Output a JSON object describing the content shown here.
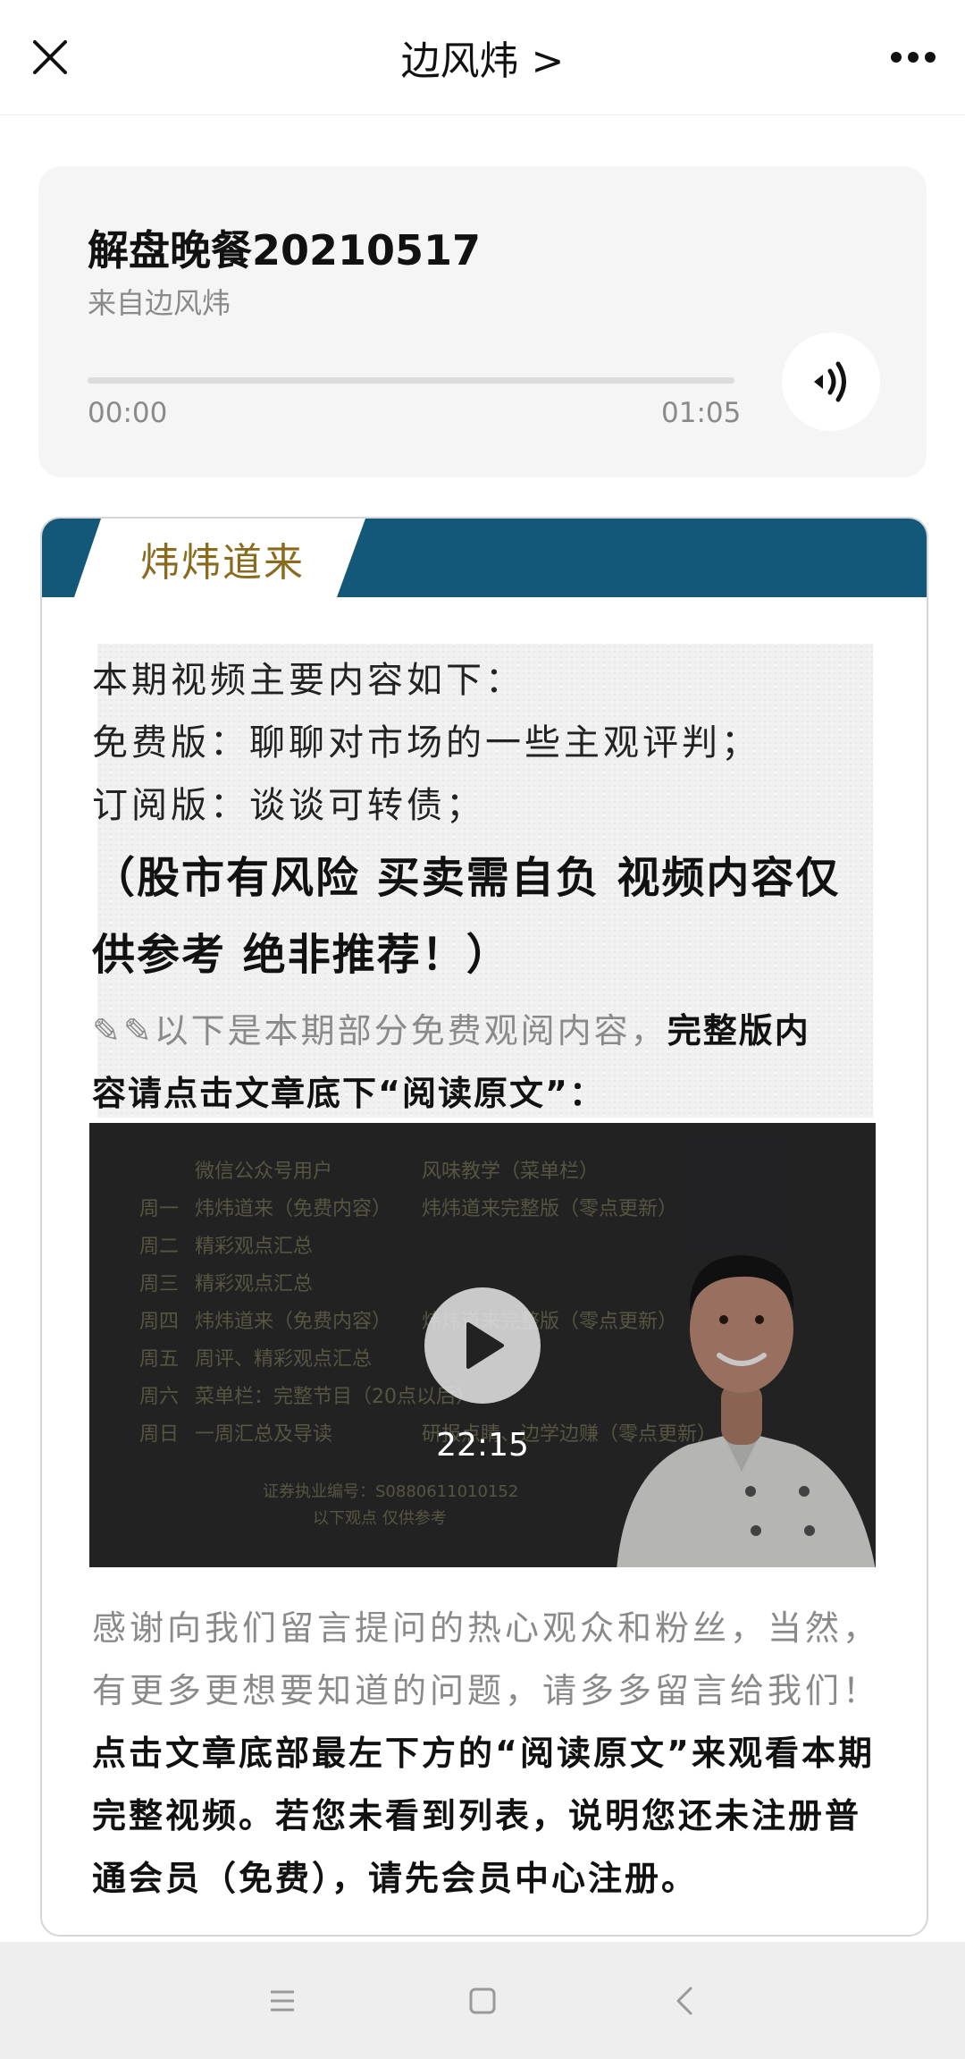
{
  "header": {
    "account_name": "边风炜 >"
  },
  "audio": {
    "title": "解盘晚餐20210517",
    "source": "来自边风炜",
    "current_time": "00:00",
    "duration": "01:05",
    "progress": 0
  },
  "article": {
    "banner_title": "炜炜道来",
    "intro_lines": [
      "本期视频主要内容如下：",
      "免费版：聊聊对市场的一些主观评判；",
      "订阅版：谈谈可转债；"
    ],
    "disclaimer_lines": [
      "（股市有风险 买卖需自负 视频内容仅",
      "供参考 绝非推荐！）"
    ],
    "preview_prefix": "✎✎以下是本期部分免费观阅内容，",
    "preview_bold": "完整版内",
    "preview_line2": "容请点击文章底下“阅读原文”：",
    "video": {
      "duration": "22:15",
      "col1_header": "微信公众号用户",
      "col2_header": "风味教学（菜单栏）",
      "rows": [
        {
          "day": "周一",
          "a": "炜炜道来（免费内容）",
          "b": "炜炜道来完整版（零点更新）"
        },
        {
          "day": "周二",
          "a": "精彩观点汇总",
          "b": ""
        },
        {
          "day": "周三",
          "a": "精彩观点汇总",
          "b": ""
        },
        {
          "day": "周四",
          "a": "炜炜道来（免费内容）",
          "b": "炜炜道来完整版（零点更新）"
        },
        {
          "day": "周五",
          "a": "周评、精彩观点汇总",
          "b": ""
        },
        {
          "day": "周六",
          "a": "菜单栏：完整节目（20点以后）",
          "b": ""
        },
        {
          "day": "周日",
          "a": "一周汇总及导读",
          "b": "研报点睛、边学边赚（零点更新）"
        }
      ],
      "license": "证券执业编号：S0880611010152",
      "note": "以下观点 仅供参考"
    },
    "outro_lines": [
      "感谢向我们留言提问的热心观众和粉丝，当然，",
      "有更多更想要知道的问题，请多多留言给我们！"
    ],
    "outro_bold_lines": [
      "点击文章底部最左下方的“阅读原文”来观看本期",
      "完整视频。若您未看到列表，说明您还未注册普",
      "通会员（免费），请先会员中心注册。"
    ]
  },
  "colors": {
    "banner": "#135878",
    "banner_text": "#8a6a1c"
  },
  "icons": [
    "close-icon",
    "more-icon",
    "speaker-icon",
    "play-icon",
    "menu-icon",
    "home-icon",
    "back-icon"
  ]
}
